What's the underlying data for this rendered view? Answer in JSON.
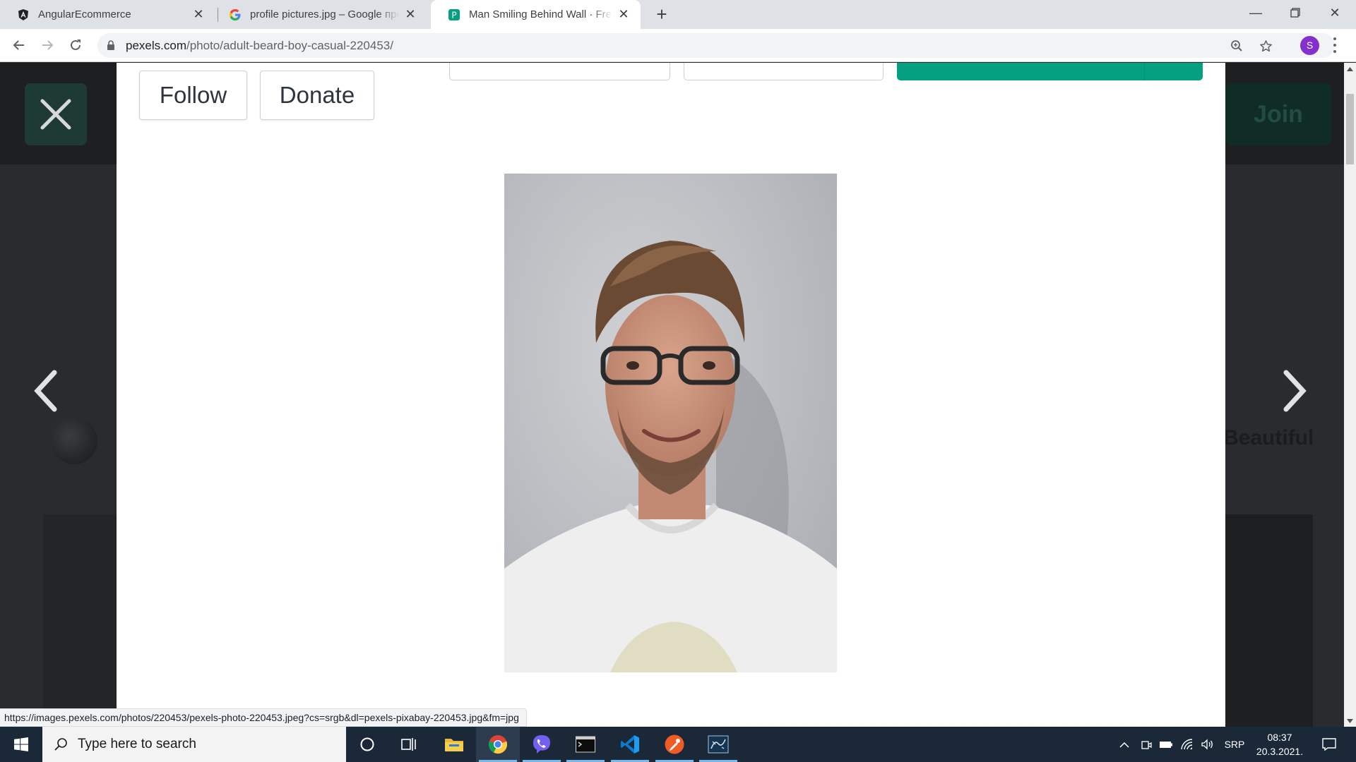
{
  "browser": {
    "tabs": [
      {
        "title": "AngularEcommerce",
        "favicon": "angular-icon",
        "active": false
      },
      {
        "title": "profile pictures.jpg – Google пре",
        "favicon": "google-icon",
        "active": false
      },
      {
        "title": "Man Smiling Behind Wall · Free S",
        "favicon": "pexels-icon",
        "active": true
      }
    ],
    "url_host": "pexels.com",
    "url_path": "/photo/adult-beard-boy-casual-220453/",
    "profile_initial": "S"
  },
  "page": {
    "join_label": "Join",
    "bg_text": "Beautiful",
    "modal": {
      "follow_label": "Follow",
      "donate_label": "Donate",
      "photo_alt": "Man Smiling Behind Wall"
    }
  },
  "status_link": "https://images.pexels.com/photos/220453/pexels-photo-220453.jpeg?cs=srgb&dl=pexels-pixabay-220453.jpg&fm=jpg",
  "taskbar": {
    "search_placeholder": "Type here to search",
    "apps": [
      "cortana-icon",
      "task-view-icon",
      "file-explorer-icon",
      "chrome-icon",
      "viber-icon",
      "terminal-icon",
      "vscode-icon",
      "postman-icon",
      "sql-icon"
    ],
    "language": "SRP",
    "time": "08:37",
    "date": "20.3.2021."
  },
  "colors": {
    "accent_green": "#05a081",
    "overlay_dark": "#292b2e",
    "taskbar": "#1b2838"
  }
}
